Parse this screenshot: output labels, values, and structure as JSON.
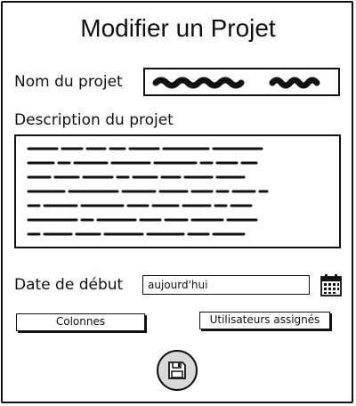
{
  "dialog": {
    "title": "Modifier un Projet"
  },
  "form": {
    "name_label": "Nom du projet",
    "description_label": "Description du projet",
    "start_date_label": "Date de début",
    "start_date_value": "aujourd'hui"
  },
  "buttons": {
    "columns_label": "Colonnes",
    "assigned_users_label": "Utilisateurs assignés"
  },
  "icons": {
    "calendar": "calendar-icon",
    "save": "floppy-disk-icon"
  }
}
